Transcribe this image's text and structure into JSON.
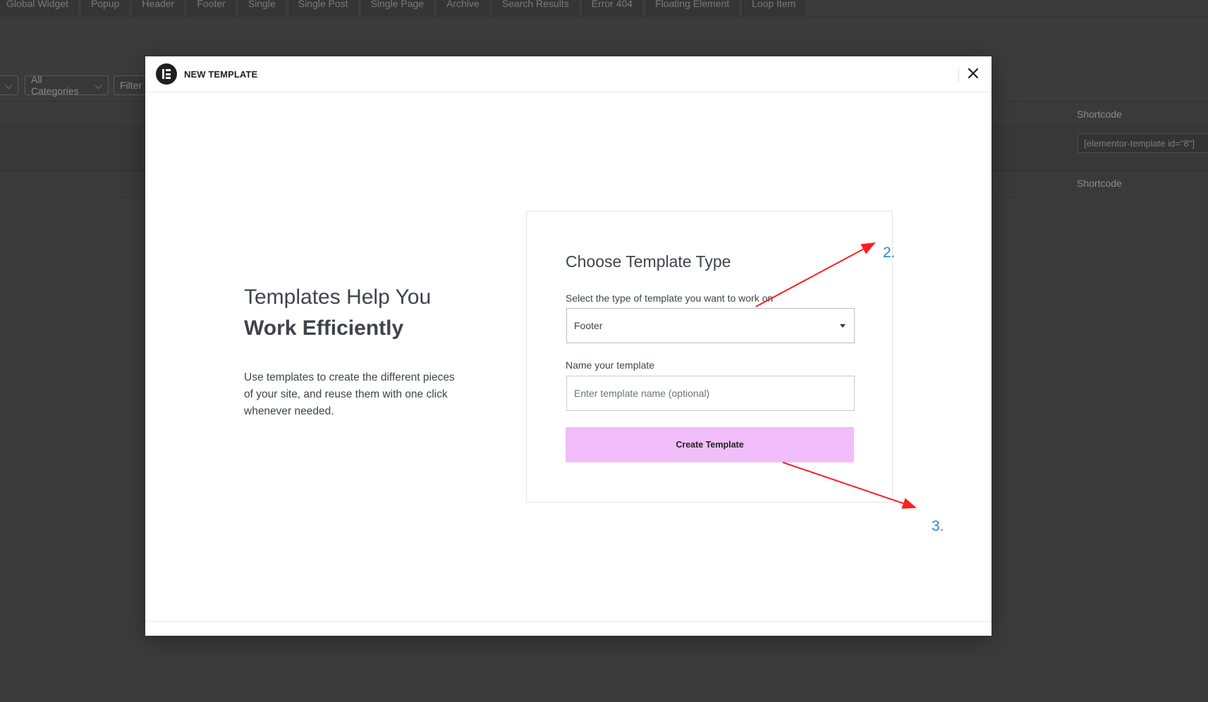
{
  "background": {
    "tabs": [
      "Global Widget",
      "Popup",
      "Header",
      "Footer",
      "Single",
      "Single Post",
      "Single Page",
      "Archive",
      "Search Results",
      "Error 404",
      "Floating Element",
      "Loop Item"
    ],
    "categories_filter": "All Categories",
    "filter_button": "Filter",
    "column_shortcode": "Shortcode",
    "column_shortcode_footer": "Shortcode",
    "shortcode_value": "[elementor-template id=\"8\"]"
  },
  "modal": {
    "title": "NEW TEMPLATE",
    "intro": {
      "line1": "Templates Help You",
      "line2": "Work Efficiently",
      "description": "Use templates to create the different pieces of your site, and reuse them with one click whenever needed."
    },
    "form": {
      "title": "Choose Template Type",
      "type_label": "Select the type of template you want to work on",
      "type_value": "Footer",
      "name_label": "Name your template",
      "name_placeholder": "Enter template name (optional)",
      "submit_label": "Create Template"
    }
  },
  "annotations": {
    "step2": "2.",
    "step3": "3.",
    "arrow_color": "#ff1f1f",
    "number_color": "#2a88d4"
  },
  "colors": {
    "button_bg": "#f1bdfa",
    "overlay": "#3b3b3b"
  }
}
